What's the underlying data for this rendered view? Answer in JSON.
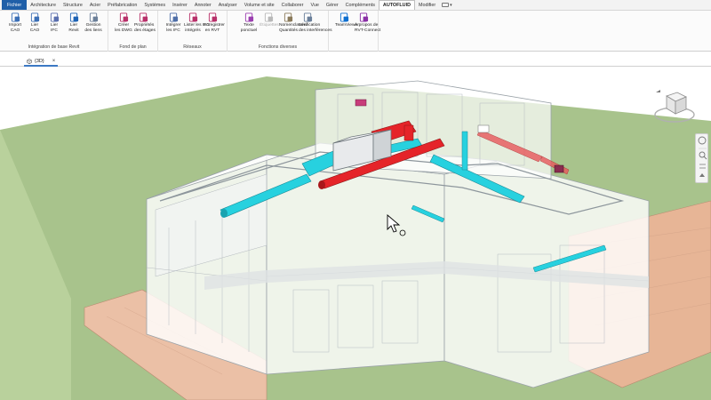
{
  "tabs": [
    {
      "label": "Fichier",
      "kind": "file"
    },
    {
      "label": "Architecture"
    },
    {
      "label": "Structure"
    },
    {
      "label": "Acier"
    },
    {
      "label": "Préfabrication"
    },
    {
      "label": "Systèmes"
    },
    {
      "label": "Insérer"
    },
    {
      "label": "Annoter"
    },
    {
      "label": "Analyser"
    },
    {
      "label": "Volume et site"
    },
    {
      "label": "Collaborer"
    },
    {
      "label": "Vue"
    },
    {
      "label": "Gérer"
    },
    {
      "label": "Compléments"
    },
    {
      "label": "AUTOFLUID",
      "active": true
    },
    {
      "label": "Modifier"
    }
  ],
  "ribbon": {
    "panels": [
      {
        "title": "Intégration de base Revit",
        "buttons": [
          {
            "line1": "Import",
            "line2": "CAO",
            "icon": "import-cad-icon",
            "color": "#3b6fb6"
          },
          {
            "line1": "Lier",
            "line2": "CAO",
            "icon": "link-cad-icon",
            "color": "#3b6fb6"
          },
          {
            "line1": "Lier",
            "line2": "IFC",
            "icon": "link-ifc-icon",
            "color": "#5a6fae"
          },
          {
            "line1": "Lier",
            "line2": "Revit",
            "icon": "link-revit-icon",
            "color": "#1e63b5"
          },
          {
            "line1": "Gestion",
            "line2": "des liens",
            "icon": "manage-links-icon",
            "color": "#6b7f99"
          }
        ]
      },
      {
        "title": "Fond de plan",
        "buttons": [
          {
            "line1": "Créer",
            "line2": "les DWG",
            "icon": "create-dwg-icon",
            "color": "#b8306a"
          },
          {
            "line1": "Propriétés",
            "line2": "des étages",
            "icon": "floor-properties-icon",
            "color": "#b8306a"
          }
        ]
      },
      {
        "title": "Réseaux",
        "buttons": [
          {
            "line1": "Intégrer",
            "line2": "les IFC",
            "icon": "integrate-ifc-icon",
            "color": "#4f6fa8"
          },
          {
            "line1": "Lister les IFC",
            "line2": "intégrés",
            "icon": "list-ifc-icon",
            "color": "#b8306a"
          },
          {
            "line1": "Enregistrer",
            "line2": "en RVT",
            "icon": "save-rvt-icon",
            "color": "#b8306a"
          }
        ]
      },
      {
        "title": "Fonctions diverses",
        "buttons": [
          {
            "line1": "Texte",
            "line2": "ponctuel",
            "icon": "point-text-icon",
            "color": "#9b3fb0"
          },
          {
            "line1": "Étiquettes",
            "line2": "",
            "icon": "tags-icon",
            "color": "#b9b9b9",
            "disabled": true
          },
          {
            "line1": "Nomenclature/",
            "line2": "Quantités",
            "icon": "schedule-icon",
            "color": "#8a7a5a"
          },
          {
            "line1": "Vérification",
            "line2": "des interférences",
            "icon": "interference-check-icon",
            "color": "#6a7f9a"
          }
        ]
      },
      {
        "title": "",
        "buttons": [
          {
            "line1": "TeamViewer",
            "line2": "",
            "icon": "teamviewer-icon",
            "color": "#0e6fd0"
          },
          {
            "line1": "À propos de",
            "line2": "RVT-Connect",
            "icon": "about-rvt-connect-icon",
            "color": "#8a2fa6"
          }
        ]
      }
    ]
  },
  "view_tab": {
    "label": "{3D}",
    "close": "×"
  },
  "colors": {
    "file_tab": "#1f5fa8",
    "supply_duct": "#2ad3e0",
    "return_duct": "#e4252a",
    "ground": "#a9c48a",
    "slab": "#e9b79a"
  }
}
